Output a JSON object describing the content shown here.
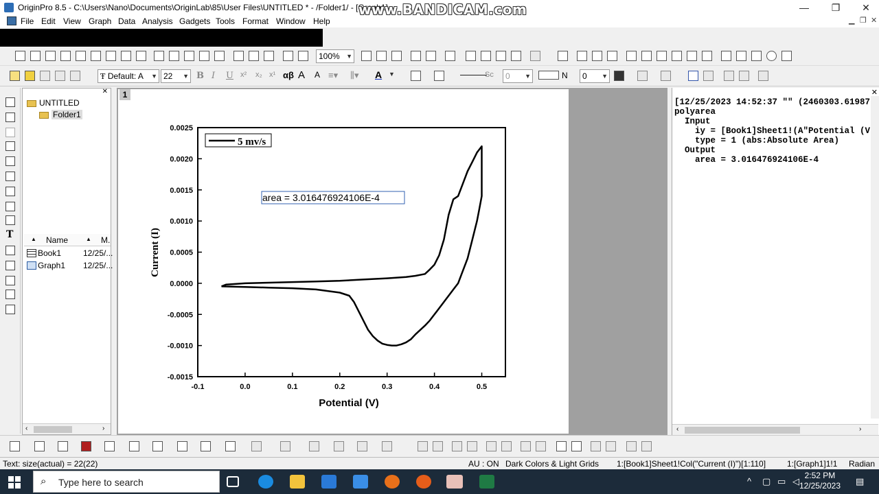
{
  "window": {
    "title": "OriginPro 8.5 - C:\\Users\\Nano\\Documents\\OriginLab\\85\\User Files\\UNTITLED * - /Folder1/ - [Graph1]",
    "watermark": "www.BANDICAM.com",
    "minimize": "—",
    "maximize": "❐",
    "close": "✕"
  },
  "menu": {
    "items": [
      "File",
      "Edit",
      "View",
      "Graph",
      "Data",
      "Analysis",
      "Gadgets",
      "Tools",
      "Format",
      "Window",
      "Help"
    ]
  },
  "toolbar": {
    "zoom": "100%",
    "font": "Default: A",
    "font_size": "22",
    "line_style": "Sc",
    "line_width": "0",
    "fill_label": "N",
    "fill_value": "0"
  },
  "explorer": {
    "root": "UNTITLED",
    "folder": "Folder1",
    "col_name": "Name",
    "col_modified": "M.",
    "items": [
      {
        "name": "Book1",
        "date": "12/25/..."
      },
      {
        "name": "Graph1",
        "date": "12/25/..."
      }
    ]
  },
  "graph": {
    "page_number": "1",
    "legend": "5 mv/s",
    "annotation": "area = 3.016476924106E-4",
    "xlabel": "Potential (V)",
    "ylabel": "Current (I)",
    "xticks": [
      "-0.1",
      "0.0",
      "0.1",
      "0.2",
      "0.3",
      "0.4",
      "0.5"
    ],
    "yticks": [
      "0.0025",
      "0.0020",
      "0.0015",
      "0.0010",
      "0.0005",
      "0.0000",
      "-0.0005",
      "-0.0010",
      "-0.0015"
    ]
  },
  "chart_data": {
    "type": "line",
    "title": "",
    "xlabel": "Potential (V)",
    "ylabel": "Current (I)",
    "xlim": [
      -0.1,
      0.55
    ],
    "ylim": [
      -0.0015,
      0.0025
    ],
    "legend": "top-left",
    "grid": false,
    "series": [
      {
        "name": "5 mv/s",
        "x": [
          -0.05,
          -0.04,
          0.0,
          0.05,
          0.1,
          0.15,
          0.2,
          0.25,
          0.3,
          0.34,
          0.36,
          0.38,
          0.39,
          0.4,
          0.41,
          0.42,
          0.43,
          0.44,
          0.45,
          0.46,
          0.47,
          0.48,
          0.49,
          0.5,
          0.5,
          0.5,
          0.495,
          0.49,
          0.48,
          0.47,
          0.46,
          0.45,
          0.44,
          0.43,
          0.42,
          0.41,
          0.4,
          0.39,
          0.38,
          0.37,
          0.36,
          0.35,
          0.34,
          0.33,
          0.32,
          0.31,
          0.3,
          0.29,
          0.28,
          0.27,
          0.26,
          0.25,
          0.24,
          0.23,
          0.22,
          0.2,
          0.15,
          0.1,
          0.05,
          0.0,
          -0.05
        ],
        "y": [
          -5e-05,
          -2e-05,
          0.0,
          1e-05,
          2e-05,
          3e-05,
          4e-05,
          6e-05,
          8e-05,
          0.0001,
          0.00012,
          0.00015,
          0.00022,
          0.0003,
          0.00045,
          0.0007,
          0.0011,
          0.00135,
          0.0014,
          0.0016,
          0.0018,
          0.00195,
          0.0021,
          0.0022,
          0.0018,
          0.0014,
          0.0012,
          0.001,
          0.0007,
          0.0004,
          0.0002,
          0.0,
          -0.0001,
          -0.0002,
          -0.0003,
          -0.0004,
          -0.0005,
          -0.0006,
          -0.00068,
          -0.00075,
          -0.00082,
          -0.0009,
          -0.00095,
          -0.00098,
          -0.001,
          -0.001,
          -0.00099,
          -0.00097,
          -0.00092,
          -0.00085,
          -0.00075,
          -0.0006,
          -0.00045,
          -0.0003,
          -0.0002,
          -0.00015,
          -0.0001,
          -8e-05,
          -7e-05,
          -6e-05,
          -5e-05
        ]
      }
    ]
  },
  "log": {
    "lines": [
      "[12/25/2023 14:52:37 \"\" (2460303.61987",
      "polyarea",
      "  Input",
      "    iy = [Book1]Sheet1!(A\"Potential (V",
      "    type = 1 (abs:Absolute Area)",
      "  Output",
      "    area = 3.016476924106E-4"
    ]
  },
  "status": {
    "text": "Text: size(actual) = 22(22)",
    "au": "AU : ON",
    "theme": "Dark Colors & Light Grids",
    "col": "1:[Book1]Sheet1!Col(\"Current (I)\")[1:110]",
    "layer": "1:[Graph1]1!1",
    "unit": "Radian"
  },
  "taskbar": {
    "search_placeholder": "Type here to search",
    "time": "2:52 PM",
    "date": "12/25/2023"
  },
  "colors": {
    "taskbar": "#1c2b3a",
    "mdi_bg": "#a0a0a0",
    "plot_line": "#000000"
  }
}
